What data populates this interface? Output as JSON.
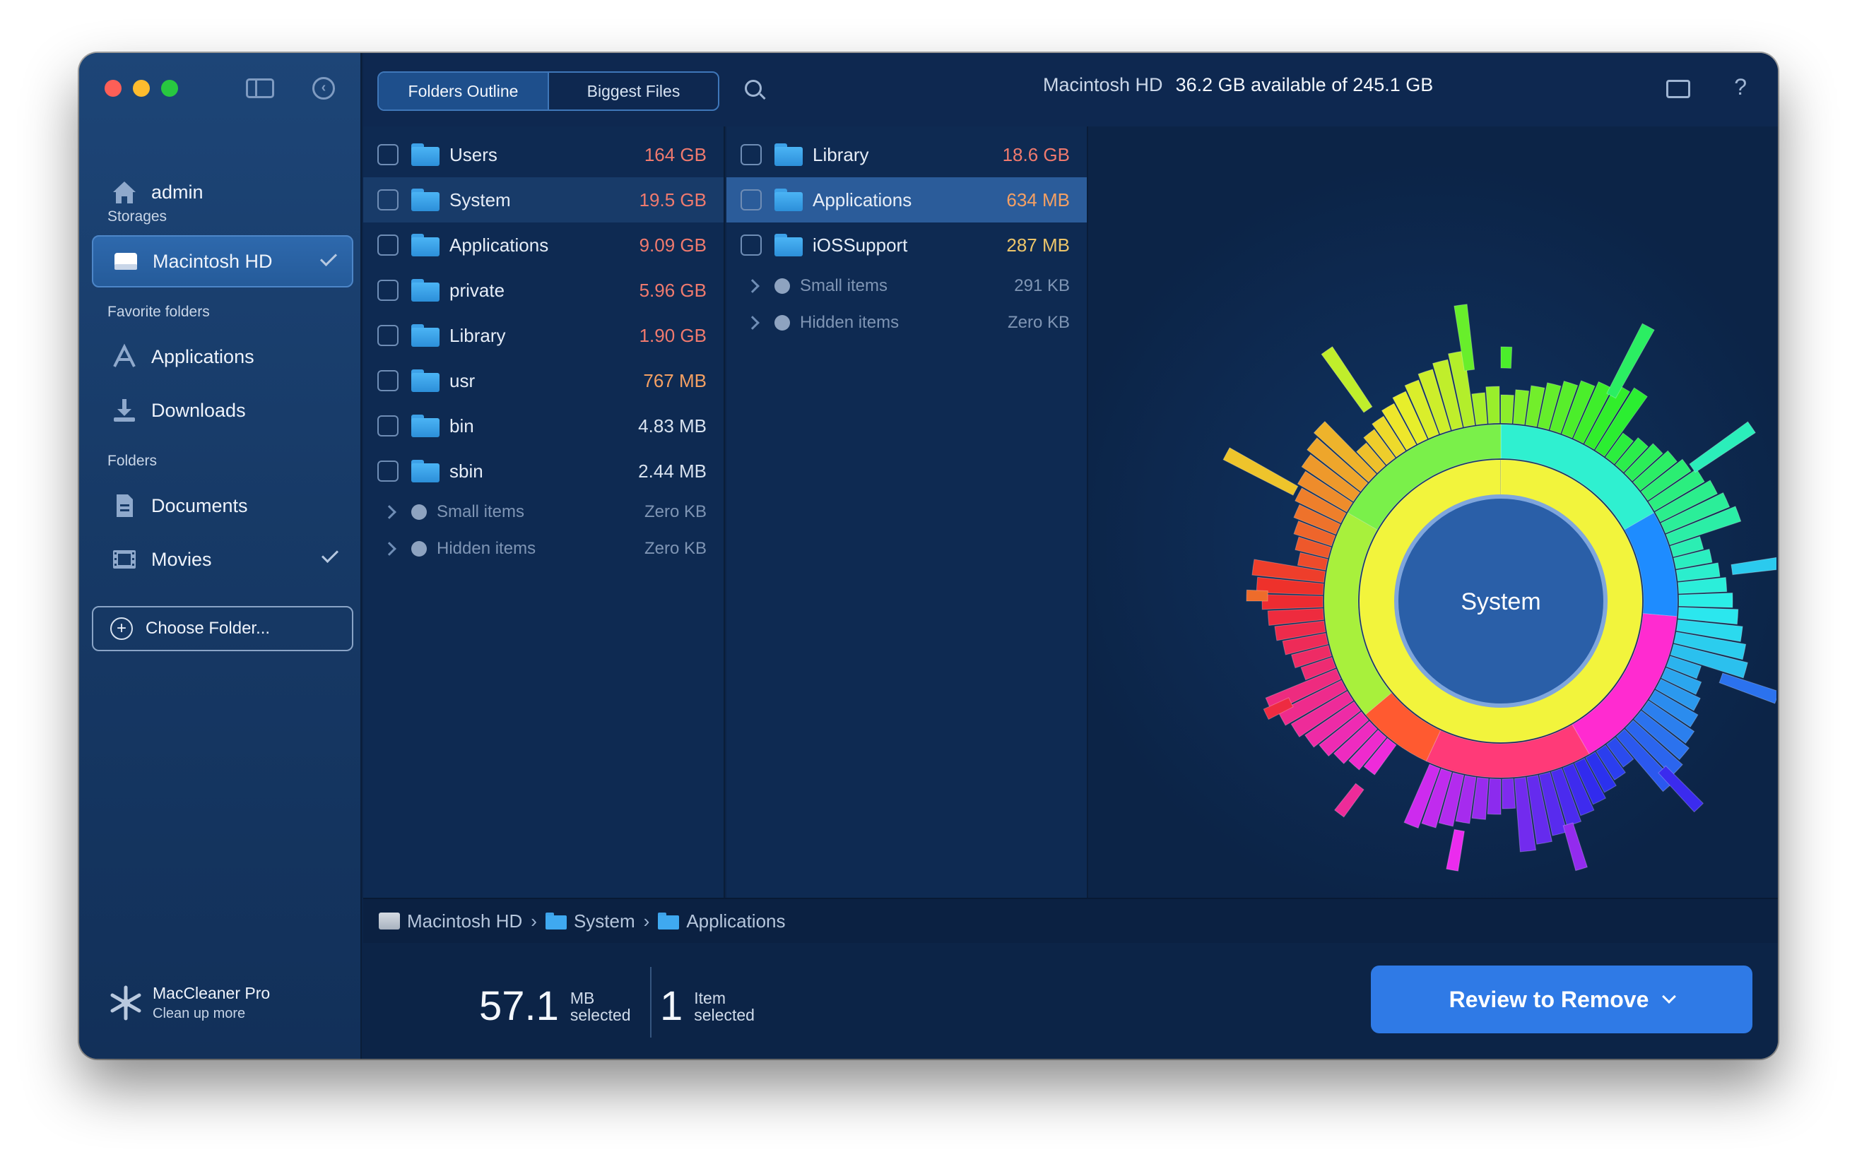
{
  "sidebar": {
    "user": "admin",
    "sections": {
      "storages": "Storages",
      "favorites": "Favorite folders",
      "folders": "Folders"
    },
    "storage_item": "Macintosh HD",
    "favorites": [
      "Applications",
      "Downloads"
    ],
    "folders": [
      "Documents",
      "Movies"
    ],
    "choose_folder": "Choose Folder...",
    "promo": {
      "name": "MacCleaner Pro",
      "sub": "Clean up more"
    }
  },
  "toolbar": {
    "tabs": [
      "Folders Outline",
      "Biggest Files"
    ],
    "disk_name": "Macintosh HD",
    "disk_space": "36.2 GB available of 245.1 GB"
  },
  "column1": {
    "rows": [
      {
        "name": "Users",
        "size": "164 GB"
      },
      {
        "name": "System",
        "size": "19.5 GB"
      },
      {
        "name": "Applications",
        "size": "9.09 GB"
      },
      {
        "name": "private",
        "size": "5.96 GB"
      },
      {
        "name": "Library",
        "size": "1.90 GB"
      },
      {
        "name": "usr",
        "size": "767 MB"
      },
      {
        "name": "bin",
        "size": "4.83 MB"
      },
      {
        "name": "sbin",
        "size": "2.44 MB"
      }
    ],
    "extra": [
      {
        "name": "Small items",
        "size": "Zero KB"
      },
      {
        "name": "Hidden items",
        "size": "Zero KB"
      }
    ]
  },
  "column2": {
    "rows": [
      {
        "name": "Library",
        "size": "18.6 GB"
      },
      {
        "name": "Applications",
        "size": "634 MB"
      },
      {
        "name": "iOSSupport",
        "size": "287 MB"
      }
    ],
    "extra": [
      {
        "name": "Small items",
        "size": "291 KB"
      },
      {
        "name": "Hidden items",
        "size": "Zero KB"
      }
    ]
  },
  "chart": {
    "center_label": "System"
  },
  "breadcrumb": [
    "Macintosh HD",
    "System",
    "Applications"
  ],
  "footer": {
    "size_value": "57.1",
    "size_unit": "MB",
    "size_label": "selected",
    "items_value": "1",
    "items_unit": "Item",
    "items_label": "selected",
    "review_button": "Review to Remove"
  }
}
